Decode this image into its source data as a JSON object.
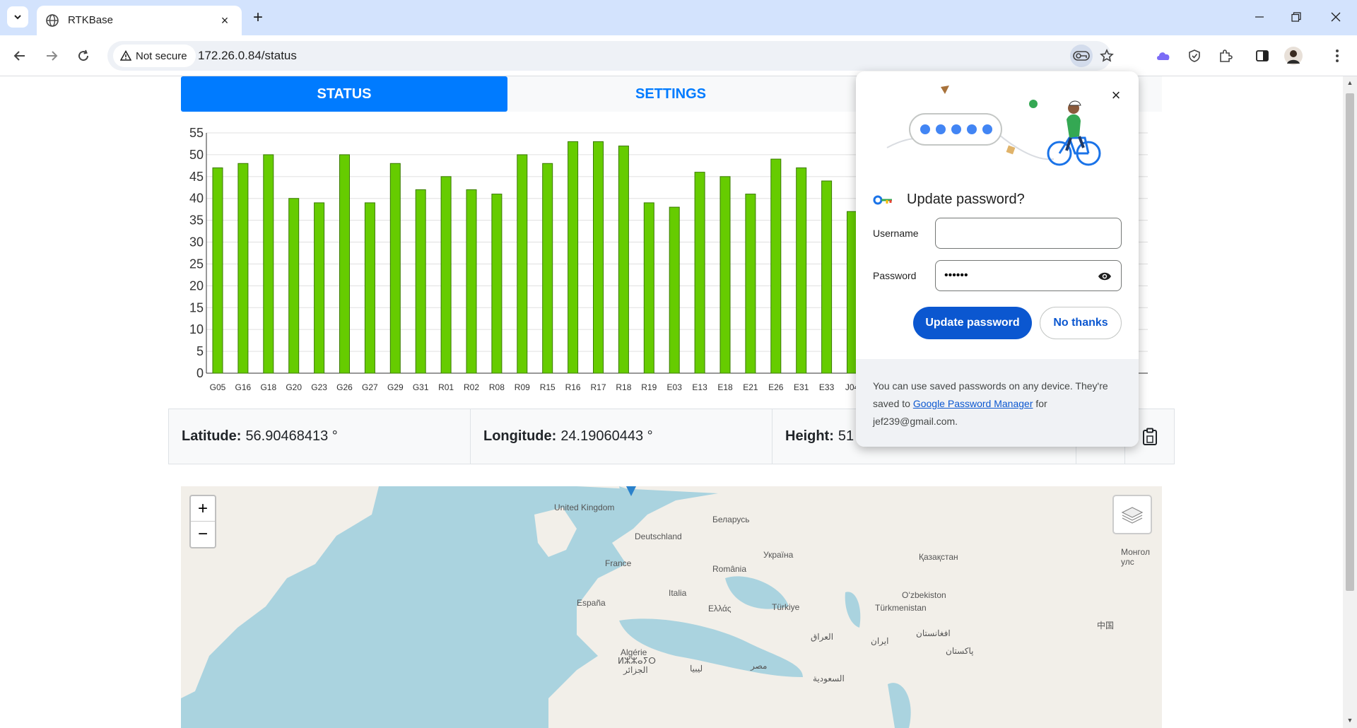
{
  "browser": {
    "tab_title": "RTKBase",
    "tab_close_glyph": "×",
    "new_tab_glyph": "+",
    "security_label": "Not secure",
    "url": "172.26.0.84/status"
  },
  "nav": {
    "tabs": [
      {
        "label": "STATUS"
      },
      {
        "label": "SETTINGS"
      }
    ]
  },
  "chart_data": {
    "type": "bar",
    "categories": [
      "G05",
      "G16",
      "G18",
      "G20",
      "G23",
      "G26",
      "G27",
      "G29",
      "G31",
      "R01",
      "R02",
      "R08",
      "R09",
      "R15",
      "R16",
      "R17",
      "R18",
      "R19",
      "E03",
      "E13",
      "E18",
      "E21",
      "E26",
      "E31",
      "E33",
      "J04"
    ],
    "values": [
      47,
      48,
      50,
      40,
      39,
      50,
      39,
      48,
      42,
      45,
      42,
      41,
      50,
      48,
      53,
      53,
      52,
      39,
      38,
      46,
      45,
      41,
      49,
      47,
      44,
      37
    ],
    "ylim": [
      0,
      55
    ],
    "yticks": [
      "0",
      "5",
      "10",
      "15",
      "20",
      "25",
      "30",
      "35",
      "40",
      "45",
      "50",
      "55"
    ],
    "bar_color": "#66cc00",
    "grid": true
  },
  "coords": {
    "latitude_label": "Latitude:",
    "latitude_value": "56.90468413 °",
    "longitude_label": "Longitude:",
    "longitude_value": "24.19060443 °",
    "height_label": "Height:",
    "height_value": "51"
  },
  "map": {
    "zoom_in": "+",
    "zoom_out": "−",
    "labels": [
      "United Kingdom",
      "Беларусь",
      "Deutschland",
      "Україна",
      "Қазақстан",
      "France",
      "România",
      "Монгол улс",
      "España",
      "Italia",
      "Oʻzbekiston",
      "Ελλάς",
      "Türkiye",
      "Türkmenistan",
      "中国",
      "العراق",
      "افغانستان",
      "Algérie",
      "ایران",
      "ⵍⵣⵣⴰⵢⵔ",
      "الجزائر",
      "پاکستان",
      "ليبيا",
      "مصر",
      "السعودية"
    ]
  },
  "password_popup": {
    "title": "Update password?",
    "close_glyph": "×",
    "username_label": "Username",
    "username_value": "",
    "password_label": "Password",
    "password_value": "••••••",
    "primary_button": "Update password",
    "secondary_button": "No thanks",
    "footer_text_1": "You can use saved passwords on any device. They're saved to ",
    "footer_link": "Google Password Manager",
    "footer_text_2": " for jef239@gmail.com."
  },
  "colors": {
    "tabbar_bg": "#d3e3fd",
    "accent": "#007bff",
    "popup_primary": "#0b57d0"
  }
}
